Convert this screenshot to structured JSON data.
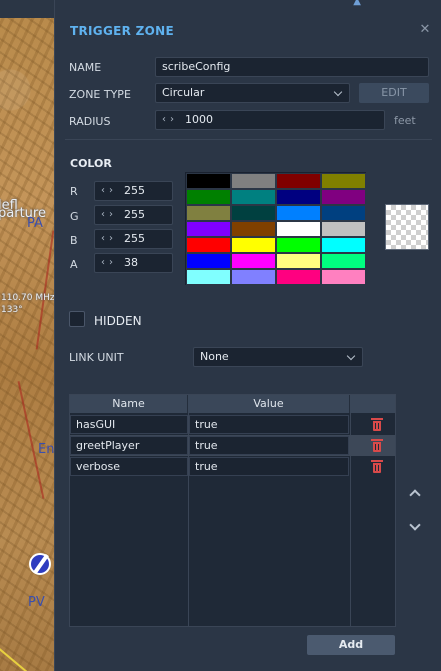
{
  "map": {
    "labels": [
      "lefl",
      "parture",
      "PA",
      "110.70 MHz",
      "133°",
      "En",
      "PV"
    ]
  },
  "panel": {
    "title": "TRIGGER ZONE",
    "close_icon": "close-icon",
    "name_label": "NAME",
    "name_value": "scribeConfig",
    "zone_type_label": "ZONE TYPE",
    "zone_type_value": "Circular",
    "edit_label": "EDIT",
    "radius_label": "RADIUS",
    "radius_value": "1000",
    "radius_unit": "feet",
    "color": {
      "title": "COLOR",
      "channels": [
        {
          "label": "R",
          "value": "255"
        },
        {
          "label": "G",
          "value": "255"
        },
        {
          "label": "B",
          "value": "255"
        },
        {
          "label": "A",
          "value": "38"
        }
      ],
      "palette": [
        "#000000",
        "#808080",
        "#800000",
        "#808000",
        "#008000",
        "#008080",
        "#000080",
        "#800080",
        "#808040",
        "#004040",
        "#0080ff",
        "#004080",
        "#8000ff",
        "#804000",
        "#ffffff",
        "#c0c0c0",
        "#ff0000",
        "#ffff00",
        "#00ff00",
        "#00ffff",
        "#0000ff",
        "#ff00ff",
        "#ffff80",
        "#00ff80",
        "#80ffff",
        "#8080ff",
        "#ff0080",
        "#ff80c0"
      ]
    },
    "hidden_label": "HIDDEN",
    "link_unit_label": "LINK UNIT",
    "link_unit_value": "None",
    "table": {
      "columns": [
        "Name",
        "Value"
      ],
      "rows": [
        {
          "name": "hasGUI",
          "value": "true"
        },
        {
          "name": "greetPlayer",
          "value": "true"
        },
        {
          "name": "verbose",
          "value": "true"
        }
      ]
    },
    "add_label": "Add"
  }
}
